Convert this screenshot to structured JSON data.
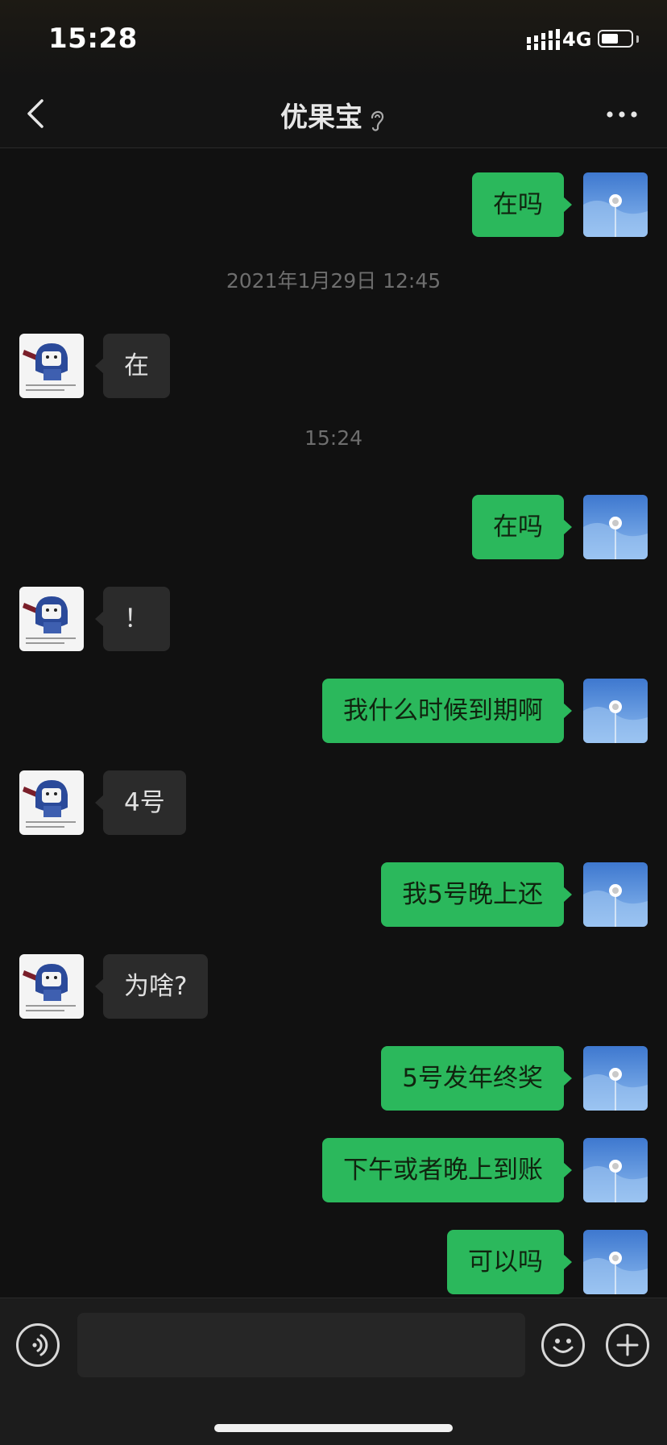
{
  "status_bar": {
    "time": "15:28",
    "network": "4G",
    "battery_level": 0.6
  },
  "header": {
    "title": "优果宝",
    "back_icon": "chevron-left-icon",
    "ear_icon": "ear-icon",
    "more_icon": "ellipsis-icon"
  },
  "messages": [
    {
      "type": "msg",
      "sender": "me",
      "text": "在吗"
    },
    {
      "type": "time",
      "text": "2021年1月29日 12:45"
    },
    {
      "type": "msg",
      "sender": "other",
      "text": "在"
    },
    {
      "type": "time",
      "text": "15:24"
    },
    {
      "type": "msg",
      "sender": "me",
      "text": "在吗"
    },
    {
      "type": "msg",
      "sender": "other",
      "text": "！"
    },
    {
      "type": "msg",
      "sender": "me",
      "text": "我什么时候到期啊"
    },
    {
      "type": "msg",
      "sender": "other",
      "text": "4号"
    },
    {
      "type": "msg",
      "sender": "me",
      "text": "我5号晚上还"
    },
    {
      "type": "msg",
      "sender": "other",
      "text": "为啥?"
    },
    {
      "type": "msg",
      "sender": "me",
      "text": "5号发年终奖"
    },
    {
      "type": "msg",
      "sender": "me",
      "text": "下午或者晚上到账"
    },
    {
      "type": "msg",
      "sender": "me",
      "text": "可以吗"
    }
  ],
  "input_bar": {
    "voice_icon": "voice-icon",
    "emoji_icon": "emoji-icon",
    "plus_icon": "plus-icon",
    "input_value": ""
  },
  "colors": {
    "background": "#111111",
    "my_bubble": "#2bb85c",
    "other_bubble": "#2b2b2b"
  }
}
